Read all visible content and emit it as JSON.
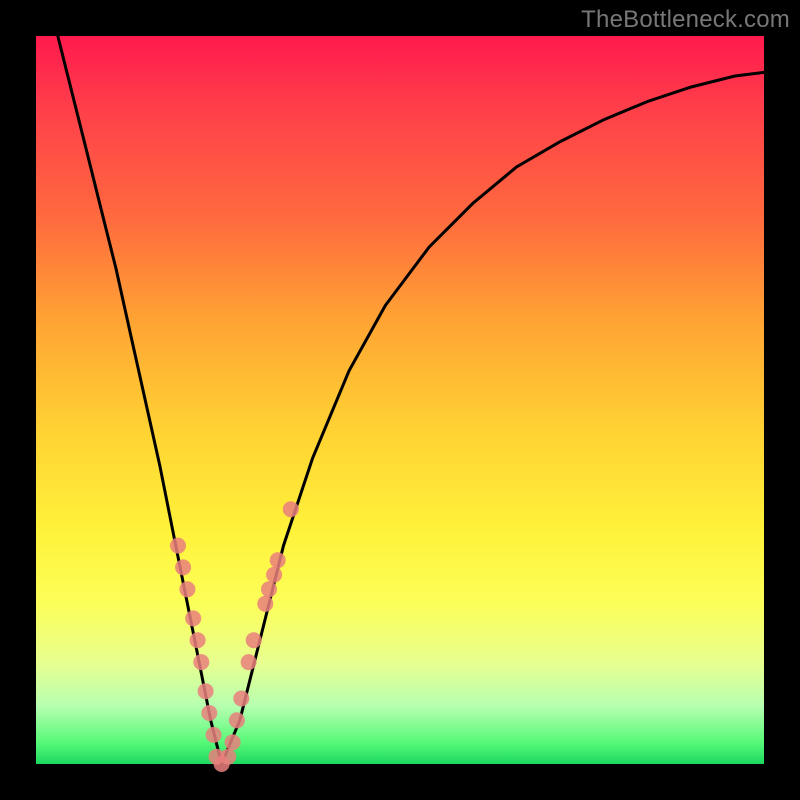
{
  "watermark": "TheBottleneck.com",
  "chart_data": {
    "type": "line",
    "title": "",
    "xlabel": "",
    "ylabel": "",
    "xlim": [
      0,
      100
    ],
    "ylim": [
      0,
      100
    ],
    "grid": false,
    "legend": false,
    "series": [
      {
        "name": "bottleneck-curve",
        "color": "#000000",
        "x": [
          3,
          5,
          7,
          9,
          11,
          13,
          15,
          17,
          19,
          22,
          24,
          25.5,
          28,
          31,
          34,
          38,
          43,
          48,
          54,
          60,
          66,
          72,
          78,
          84,
          90,
          96,
          100
        ],
        "y": [
          100,
          92,
          84,
          76,
          68,
          59,
          50,
          41,
          31,
          16,
          6,
          0,
          6,
          18,
          30,
          42,
          54,
          63,
          71,
          77,
          82,
          85.5,
          88.5,
          91,
          93,
          94.5,
          95
        ]
      }
    ],
    "markers": [
      {
        "name": "left-cluster",
        "color": "#e97f7d",
        "points": [
          {
            "x": 19.5,
            "y": 30
          },
          {
            "x": 20.2,
            "y": 27
          },
          {
            "x": 20.8,
            "y": 24
          },
          {
            "x": 21.6,
            "y": 20
          },
          {
            "x": 22.2,
            "y": 17
          },
          {
            "x": 22.7,
            "y": 14
          },
          {
            "x": 23.3,
            "y": 10
          },
          {
            "x": 23.8,
            "y": 7
          },
          {
            "x": 24.4,
            "y": 4
          }
        ]
      },
      {
        "name": "valley-cluster",
        "color": "#e97f7d",
        "points": [
          {
            "x": 24.8,
            "y": 1
          },
          {
            "x": 25.5,
            "y": 0
          },
          {
            "x": 26.4,
            "y": 1
          },
          {
            "x": 27.0,
            "y": 3
          }
        ]
      },
      {
        "name": "right-cluster",
        "color": "#e97f7d",
        "points": [
          {
            "x": 27.6,
            "y": 6
          },
          {
            "x": 28.2,
            "y": 9
          },
          {
            "x": 29.2,
            "y": 14
          },
          {
            "x": 29.9,
            "y": 17
          },
          {
            "x": 31.5,
            "y": 22
          },
          {
            "x": 32.0,
            "y": 24
          },
          {
            "x": 32.7,
            "y": 26
          },
          {
            "x": 33.2,
            "y": 28
          },
          {
            "x": 35.0,
            "y": 35
          }
        ]
      }
    ]
  }
}
